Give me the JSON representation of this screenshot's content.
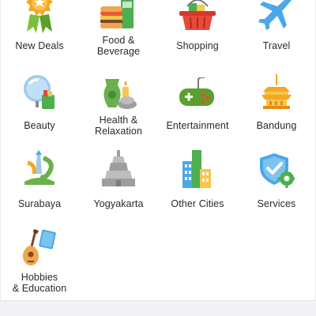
{
  "categories": [
    {
      "label": "New Deals",
      "icon": "deal-badge-icon"
    },
    {
      "label": "Food &\nBeverage",
      "icon": "food-beverage-icon"
    },
    {
      "label": "Shopping",
      "icon": "shopping-basket-icon"
    },
    {
      "label": "Travel",
      "icon": "airplane-icon"
    },
    {
      "label": "Beauty",
      "icon": "mirror-cosmetics-icon"
    },
    {
      "label": "Health &\nRelaxation",
      "icon": "spa-icon"
    },
    {
      "label": "Entertainment",
      "icon": "game-controller-icon"
    },
    {
      "label": "Bandung",
      "icon": "bandung-landmark-icon"
    },
    {
      "label": "Surabaya",
      "icon": "surabaya-monument-icon"
    },
    {
      "label": "Yogyakarta",
      "icon": "temple-icon"
    },
    {
      "label": "Other Cities",
      "icon": "city-buildings-icon"
    },
    {
      "label": "Services",
      "icon": "shield-gear-icon"
    },
    {
      "label": "Hobbies\n& Education",
      "icon": "guitar-book-icon"
    }
  ]
}
